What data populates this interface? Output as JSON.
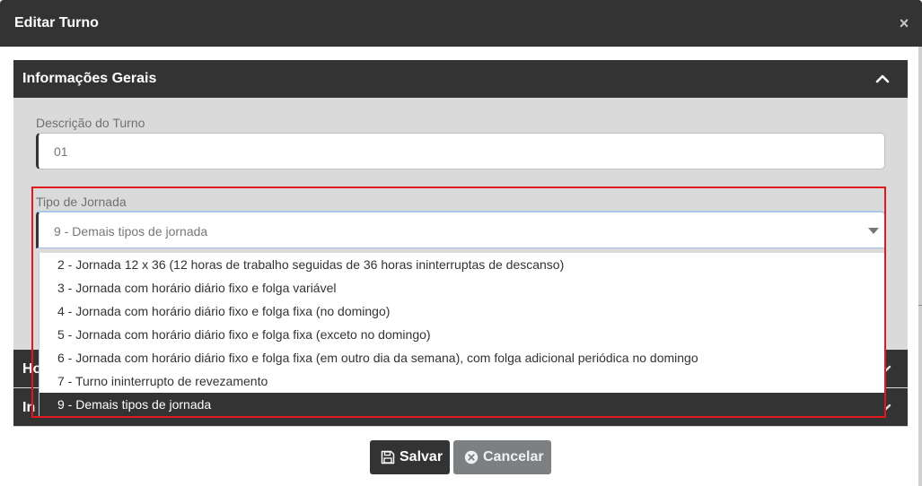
{
  "modal": {
    "title": "Editar Turno",
    "close_glyph": "×"
  },
  "general_panel": {
    "title": "Informações Gerais",
    "description_label": "Descrição do Turno",
    "description_value": "01",
    "journey_label": "Tipo de Jornada",
    "journey_selected": "9 - Demais tipos de jornada",
    "journey_options": [
      "2 - Jornada 12 x 36 (12 horas de trabalho seguidas de 36 horas ininterruptas de descanso)",
      "3 - Jornada com horário diário fixo e folga variável",
      "4 - Jornada com horário diário fixo e folga fixa (no domingo)",
      "5 - Jornada com horário diário fixo e folga fixa (exceto no domingo)",
      "6 - Jornada com horário diário fixo e folga fixa (em outro dia da semana), com folga adicional periódica no domingo",
      "7 - Turno ininterrupto de revezamento",
      "9 - Demais tipos de jornada"
    ],
    "selected_option_index": 6
  },
  "collapsed_sections": [
    {
      "title_visible": "Ho"
    },
    {
      "title_visible": "In"
    }
  ],
  "footer": {
    "save_label": "Salvar",
    "cancel_label": "Cancelar"
  },
  "colors": {
    "header_dark": "#333333",
    "panel_bg": "#dadada",
    "highlight_red": "#e3171e",
    "cancel_gray": "#7c8083"
  }
}
